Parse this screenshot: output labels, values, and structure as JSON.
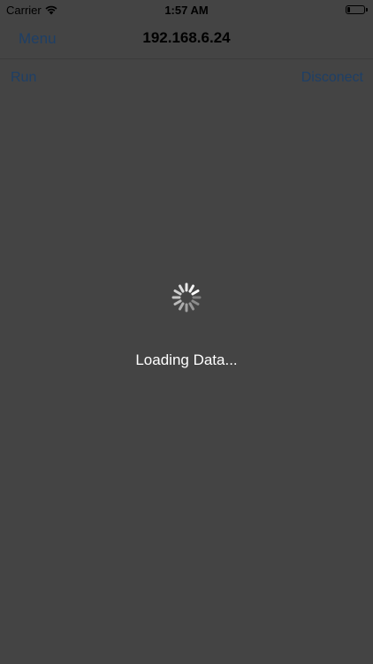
{
  "status_bar": {
    "carrier": "Carrier",
    "time": "1:57 AM",
    "wifi_icon": "wifi-icon",
    "battery_icon": "battery-icon",
    "battery_level_percent": 15
  },
  "nav": {
    "left_label": "Menu",
    "title": "192.168.6.24"
  },
  "toolbar": {
    "run_label": "Run",
    "disconnect_label": "Disconect"
  },
  "loading": {
    "spinner_icon": "activity-spinner-icon",
    "text": "Loading Data..."
  },
  "colors": {
    "background": "#444444",
    "link": "#1e3f66",
    "title": "#000000",
    "loading_text": "#ffffff"
  }
}
